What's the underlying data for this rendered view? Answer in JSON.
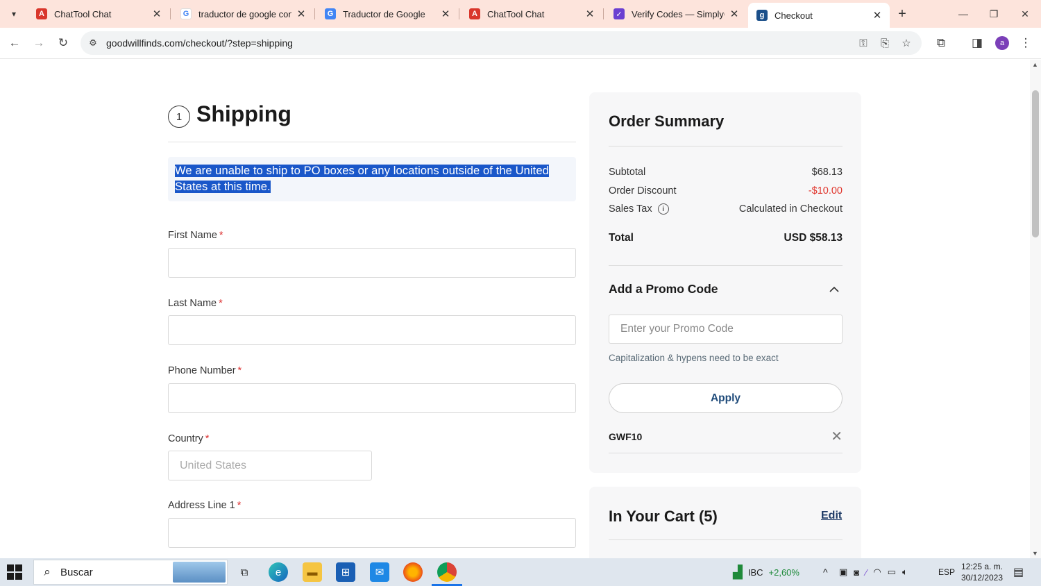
{
  "browser": {
    "tabs": [
      {
        "title": "ChatTool Chat",
        "icon": "chattool-logo-icon",
        "icon_color": "#d9362b"
      },
      {
        "title": "traductor de google con dibujo",
        "icon": "google-logo-icon",
        "icon_color": "#4285f4"
      },
      {
        "title": "Traductor de Google",
        "icon": "google-translate-icon",
        "icon_color": "#4285f4"
      },
      {
        "title": "ChatTool Chat",
        "icon": "chattool-logo-icon",
        "icon_color": "#d9362b"
      },
      {
        "title": "Verify Codes — SimplyCodes",
        "icon": "simplycodes-logo-icon",
        "icon_color": "#6a3fd1"
      },
      {
        "title": "Checkout",
        "icon": "goodwill-logo-icon",
        "icon_color": "#1b4f8a",
        "active": true
      }
    ],
    "url": "goodwillfinds.com/checkout/?step=shipping",
    "profile_initial": "a"
  },
  "shipping": {
    "step": "1",
    "title": "Shipping",
    "notice": "We are unable to ship to PO boxes or any locations outside of the United States at this time.",
    "fields": {
      "first_name": {
        "label": "First Name",
        "required": "*",
        "value": ""
      },
      "last_name": {
        "label": "Last Name",
        "required": "*",
        "value": ""
      },
      "phone": {
        "label": "Phone Number",
        "required": "*",
        "value": ""
      },
      "country": {
        "label": "Country",
        "required": "*",
        "placeholder": "United States"
      },
      "address1": {
        "label": "Address Line 1",
        "required": "*",
        "value": ""
      }
    }
  },
  "summary": {
    "title": "Order Summary",
    "subtotal_label": "Subtotal",
    "subtotal": "$68.13",
    "discount_label": "Order Discount",
    "discount": "-$10.00",
    "tax_label": "Sales Tax",
    "tax": "Calculated in Checkout",
    "total_label": "Total",
    "total": "USD $58.13",
    "promo_title": "Add a Promo Code",
    "promo_placeholder": "Enter your Promo Code",
    "promo_hint": "Capitalization & hypens need to be exact",
    "apply_label": "Apply",
    "applied_code": "GWF10"
  },
  "cart": {
    "title": "In Your Cart (5)",
    "edit_label": "Edit"
  },
  "taskbar": {
    "search_label": "Buscar",
    "stock_name": "IBC",
    "stock_change": "+2,60%",
    "language": "ESP",
    "time": "12:25 a. m.",
    "date": "30/12/2023"
  },
  "colors": {
    "tabstrip": "#fde4dc",
    "selection": "#1a57c9",
    "discount": "#e0342b",
    "edit_link": "#1f3b66",
    "stock_up": "#1f8a3a"
  }
}
